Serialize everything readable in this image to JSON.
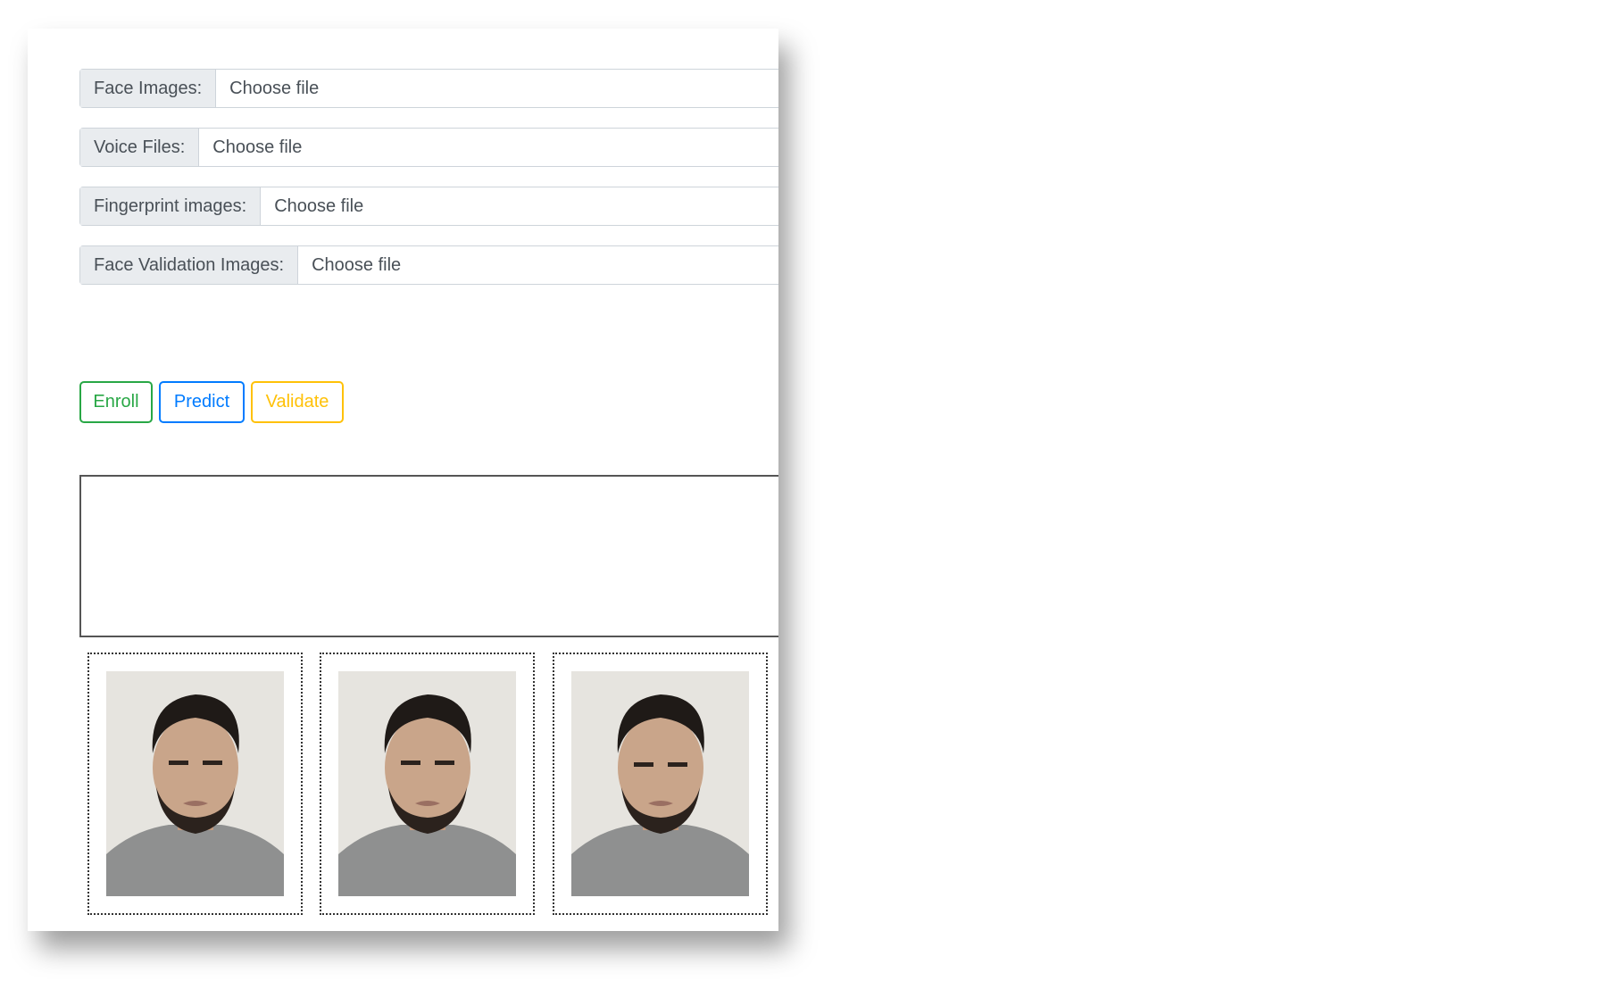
{
  "form": {
    "fields": [
      {
        "label": "Face Images:",
        "value": "Choose file"
      },
      {
        "label": "Voice Files:",
        "value": "Choose file"
      },
      {
        "label": "Fingerprint images:",
        "value": "Choose file"
      },
      {
        "label": "Face Validation Images:",
        "value": "Choose file"
      }
    ]
  },
  "buttons": {
    "enroll_label": "Enroll",
    "predict_label": "Predict",
    "validate_label": "Validate"
  },
  "output": {
    "text": ""
  },
  "colors": {
    "enroll": "#28a745",
    "predict": "#007bff",
    "validate": "#ffc107",
    "label_bg": "#e9ecef",
    "border": "#ced4da"
  },
  "gallery": {
    "images": [
      {
        "icon": "face-photo"
      },
      {
        "icon": "face-photo"
      },
      {
        "icon": "face-photo"
      }
    ]
  }
}
